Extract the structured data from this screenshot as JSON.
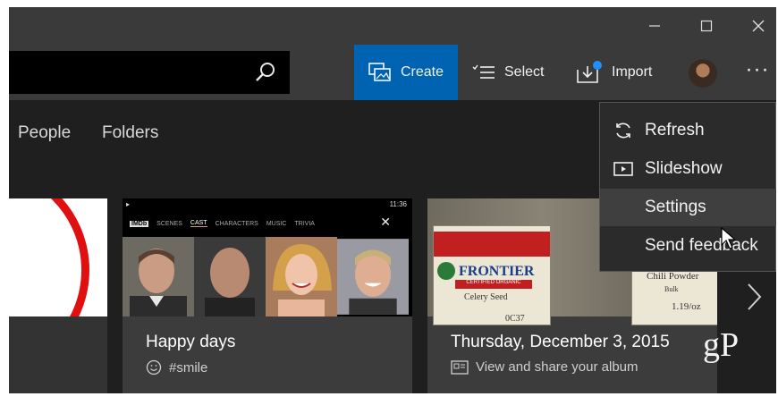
{
  "window": {
    "controls": [
      "minimize",
      "maximize",
      "close"
    ]
  },
  "toolbar": {
    "create_label": "Create",
    "select_label": "Select",
    "import_label": "Import",
    "more_label": "···",
    "accent_color": "#0063b1"
  },
  "nav": {
    "tabs": [
      {
        "label": "People"
      },
      {
        "label": "Folders"
      }
    ]
  },
  "phone": {
    "brand": "IMDb",
    "tabs": [
      "SCENES",
      "CAST",
      "CHARACTERS",
      "MUSIC",
      "TRIVIA"
    ],
    "active_tab": "CAST",
    "clock": "11:36"
  },
  "cards": [
    {
      "title": "Happy days",
      "subtitle": "#smile",
      "icon": "smiley-icon"
    },
    {
      "title": "Thursday, December 3, 2015",
      "subtitle": "View and share your album",
      "icon": "album-icon"
    }
  ],
  "product": {
    "brand": "FRONTIER",
    "line": "CERTIFIED ORGANIC",
    "item1": "Celery Seed",
    "item2": "Chili Powder",
    "item2_sub": "Bulk",
    "code": "0C37",
    "price": "1.19/oz"
  },
  "menu": {
    "items": [
      {
        "label": "Refresh",
        "icon": "refresh-icon"
      },
      {
        "label": "Slideshow",
        "icon": "slideshow-icon"
      },
      {
        "label": "Settings",
        "icon": ""
      },
      {
        "label": "Send feedback",
        "icon": ""
      }
    ],
    "hovered": "Settings"
  },
  "watermark": "gP"
}
